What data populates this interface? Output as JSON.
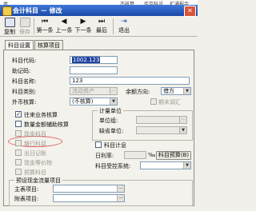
{
  "background_strip": {
    "items": [
      "体",
      "不核算",
      "库存科设",
      "扩通报余"
    ]
  },
  "titlebar": {
    "title": "会计科目 － 修改"
  },
  "toolbar": {
    "copy": "复制",
    "save": "保存",
    "first": "第一条",
    "prev": "上一条",
    "next": "下一条",
    "last": "最后",
    "exit": "退出"
  },
  "tabs": [
    "科目设置",
    "核算项目"
  ],
  "form": {
    "code_label": "科目代码:",
    "code_value": "1002.123",
    "mnemonic_label": "助记码:",
    "mnemonic_value": "",
    "name_label": "科目名称:",
    "name_value": "123",
    "category_label": "科目类别:",
    "category_value": "流动资产",
    "currency_label": "外币核算:",
    "currency_value": "(不核算)",
    "balance_dir_label": "余额方向:",
    "balance_dir_value": "借方",
    "period_end_adjust": "期末调汇"
  },
  "checkboxes": [
    {
      "label": "往来业务核算",
      "checked": true,
      "disabled": false
    },
    {
      "label": "数量金额辅助核算",
      "checked": false,
      "disabled": false
    },
    {
      "label": "现金科目",
      "checked": false,
      "disabled": true
    },
    {
      "label": "银行科目",
      "checked": false,
      "disabled": true
    },
    {
      "label": "出日记账",
      "checked": false,
      "disabled": true
    },
    {
      "label": "现金等价物",
      "checked": false,
      "disabled": true
    },
    {
      "label": "预算科目",
      "checked": false,
      "disabled": true
    }
  ],
  "measure": {
    "title": "计量单位",
    "unit_group_label": "单位组:",
    "default_unit_label": "缺省单位:"
  },
  "interest": {
    "checkbox_label": "科目计息",
    "daily_rate_label": "日利率:",
    "daily_rate_unit": "‰",
    "budget_button": "科目预算(B)",
    "control_label": "科目受控系统:"
  },
  "preset_group": {
    "title": "预设现金流量项目",
    "main_label": "主表项目:",
    "attached_label": "附表项目:"
  }
}
